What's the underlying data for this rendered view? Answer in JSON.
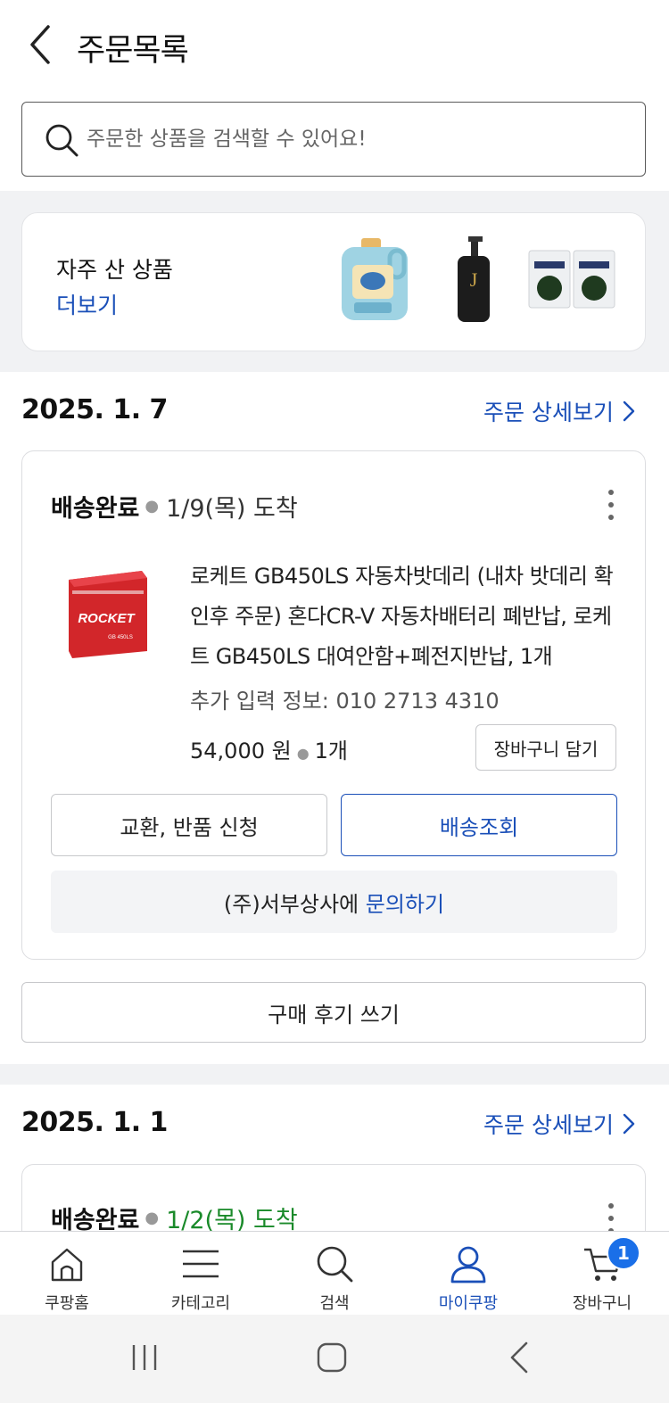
{
  "header": {
    "title": "주문목록"
  },
  "search": {
    "placeholder": "주문한 상품을 검색할 수 있어요!"
  },
  "frequent": {
    "title": "자주 산 상품",
    "more": "더보기",
    "items": [
      "detergent-bottle",
      "shampoo-bottle",
      "seaweed-pack"
    ]
  },
  "orders": [
    {
      "date": "2025. 1. 7",
      "detail_link": "주문 상세보기",
      "status": "배송완료",
      "arrival": "1/9(목) 도착",
      "product_name": "로케트 GB450LS 자동차밧데리 (내차 밧데리 확인후 주문) 혼다CR-V 자동차배터리 폐반납, 로케트 GB450LS 대여안함+폐전지반납, 1개",
      "extra_info": "추가 입력 정보: 010 2713 4310",
      "price": "54,000 원",
      "quantity": "1개",
      "cart_button": "장바구니 담기",
      "exchange_button": "교환, 반품 신청",
      "tracking_button": "배송조회",
      "seller": "(주)서부상사에",
      "inquiry": "문의하기",
      "review_button": "구매 후기 쓰기",
      "image_label": "ROCKET",
      "image_sublabel": "GB 450LS"
    },
    {
      "date": "2025. 1. 1",
      "detail_link": "주문 상세보기",
      "status": "배송완료",
      "arrival": "1/2(목) 도착"
    }
  ],
  "tabbar": {
    "tabs": [
      {
        "label": "쿠팡홈",
        "icon": "home-icon"
      },
      {
        "label": "카테고리",
        "icon": "menu-icon"
      },
      {
        "label": "검색",
        "icon": "search-icon"
      },
      {
        "label": "마이쿠팡",
        "icon": "user-icon"
      },
      {
        "label": "장바구니",
        "icon": "cart-icon"
      }
    ],
    "active": "마이쿠팡",
    "cart_badge": "1"
  },
  "colors": {
    "accent": "#1a4fb8",
    "green": "#1a8a2a",
    "badge": "#1a6fe8",
    "band": "#f1f2f4"
  }
}
